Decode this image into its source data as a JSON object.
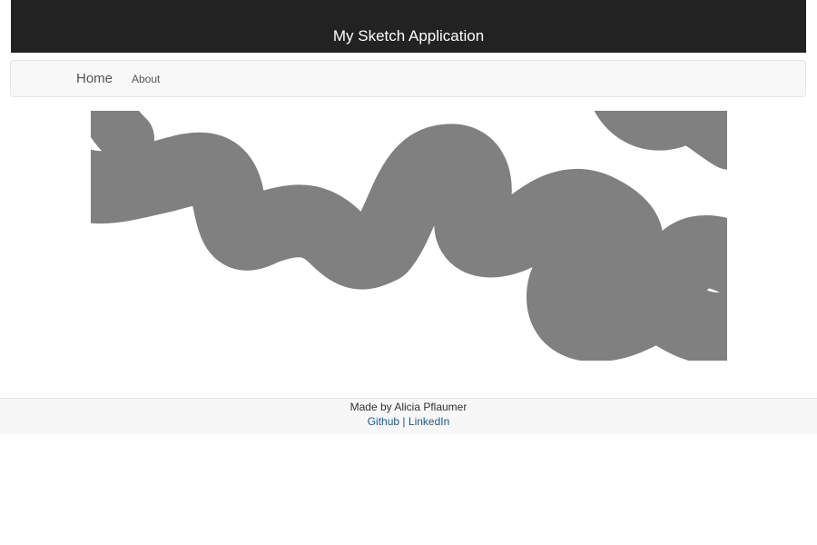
{
  "header": {
    "title": "My Sketch Application"
  },
  "nav": {
    "home_label": "Home",
    "about_label": "About"
  },
  "canvas": {
    "stroke_color": "#808080",
    "background": "#ffffff"
  },
  "footer": {
    "credit": "Made by Alicia Pflaumer",
    "github_label": "Github",
    "separator": "|",
    "linkedin_label": "LinkedIn"
  }
}
